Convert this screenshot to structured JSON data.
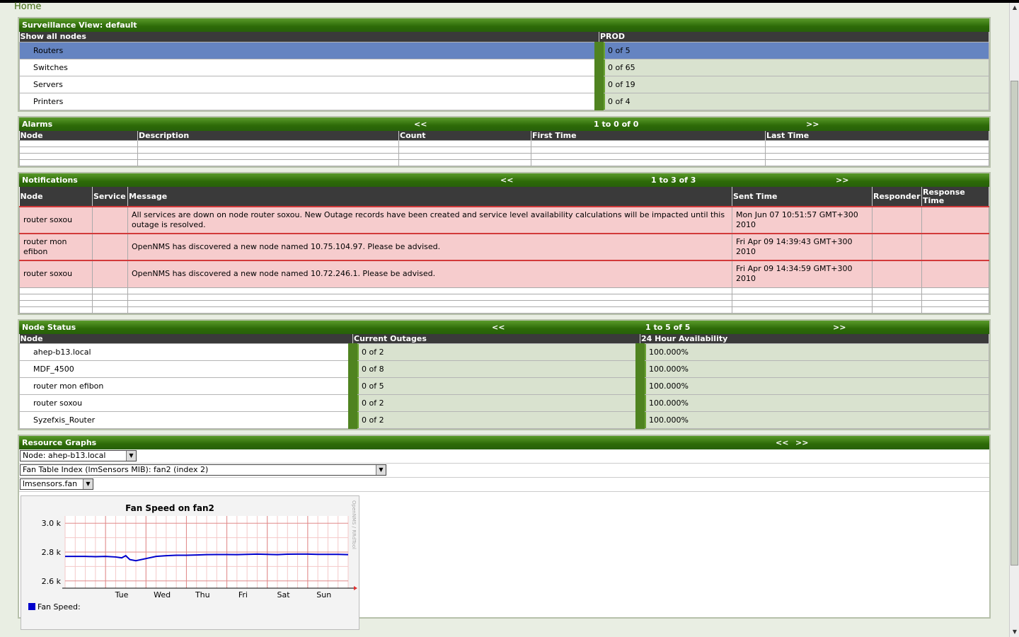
{
  "home": "Home",
  "surveillance": {
    "title": "Surveillance View: default",
    "col1": "Show all nodes",
    "col2": "PROD",
    "rows": [
      {
        "label": "Routers",
        "value": "0 of 5"
      },
      {
        "label": "Switches",
        "value": "0 of 65"
      },
      {
        "label": "Servers",
        "value": "0 of 19"
      },
      {
        "label": "Printers",
        "value": "0 of 4"
      }
    ]
  },
  "alarms": {
    "title": "Alarms",
    "prev": "<<",
    "range": "1 to 0 of 0",
    "next": ">>",
    "columns": [
      "Node",
      "Description",
      "Count",
      "First Time",
      "Last Time"
    ]
  },
  "notifications": {
    "title": "Notifications",
    "prev": "<<",
    "range": "1 to 3 of 3",
    "next": ">>",
    "columns": [
      "Node",
      "Service",
      "Message",
      "Sent Time",
      "Responder",
      "Response Time"
    ],
    "rows": [
      {
        "node": "router soxou",
        "service": "",
        "message": "All services are down on node router soxou. New Outage records have been created and service level availability calculations will be impacted until this outage is resolved.",
        "sent": "Mon Jun 07 10:51:57 GMT+300 2010",
        "responder": "",
        "response": ""
      },
      {
        "node": "router mon efibon",
        "service": "",
        "message": "OpenNMS has discovered a new node named 10.75.104.97. Please be advised.",
        "sent": "Fri Apr 09 14:39:43 GMT+300 2010",
        "responder": "",
        "response": ""
      },
      {
        "node": "router soxou",
        "service": "",
        "message": "OpenNMS has discovered a new node named 10.72.246.1. Please be advised.",
        "sent": "Fri Apr 09 14:34:59 GMT+300 2010",
        "responder": "",
        "response": ""
      }
    ]
  },
  "node_status": {
    "title": "Node Status",
    "prev": "<<",
    "range": "1 to 5 of 5",
    "next": ">>",
    "columns": [
      "Node",
      "Current Outages",
      "24 Hour Availability"
    ],
    "rows": [
      {
        "node": "ahep-b13.local",
        "outages": "0 of 2",
        "avail": "100.000%"
      },
      {
        "node": "MDF_4500",
        "outages": "0 of 8",
        "avail": "100.000%"
      },
      {
        "node": "router mon efibon",
        "outages": "0 of 5",
        "avail": "100.000%"
      },
      {
        "node": "router soxou",
        "outages": "0 of 2",
        "avail": "100.000%"
      },
      {
        "node": "Syzefxis_Router",
        "outages": "0 of 2",
        "avail": "100.000%"
      }
    ]
  },
  "resource_graphs": {
    "title": "Resource Graphs",
    "prev": "<<",
    "next": ">>",
    "node_select": "Node: ahep-b13.local",
    "resource_select": "Fan Table Index (lmSensors MIB): fan2 (index 2)",
    "graph_select": "lmsensors.fan",
    "watermark": "OpenNMS / RRdTool",
    "legend": "Fan Speed:"
  },
  "chart_data": {
    "type": "line",
    "title": "Fan Speed on fan2",
    "xlabel": "",
    "ylabel": "",
    "x_ticks": [
      "Tue",
      "Wed",
      "Thu",
      "Fri",
      "Sat",
      "Sun"
    ],
    "y_ticks": [
      "3.0 k",
      "2.8 k",
      "2.6 k"
    ],
    "ylim": [
      2550,
      3050
    ],
    "series": [
      {
        "name": "Fan Speed:",
        "color": "#0000cc",
        "x": [
          0,
          0.25,
          0.5,
          0.75,
          1,
          1.25,
          1.4,
          1.5,
          1.6,
          1.75,
          2,
          2.25,
          2.5,
          2.75,
          3,
          3.25,
          3.5,
          3.75,
          4,
          4.25,
          4.5,
          4.75,
          5,
          5.25,
          5.5,
          5.75,
          6,
          6.25,
          6.5,
          6.75,
          7
        ],
        "values": [
          2770,
          2770,
          2770,
          2768,
          2770,
          2766,
          2760,
          2775,
          2748,
          2740,
          2755,
          2770,
          2775,
          2778,
          2778,
          2780,
          2782,
          2783,
          2783,
          2782,
          2784,
          2786,
          2784,
          2782,
          2785,
          2786,
          2786,
          2784,
          2784,
          2784,
          2782
        ]
      }
    ]
  }
}
